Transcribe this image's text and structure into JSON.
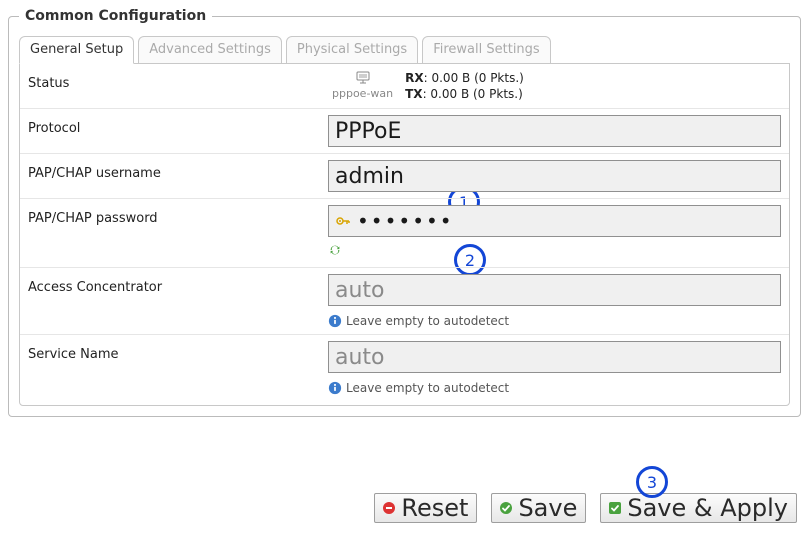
{
  "fieldset_title": "Common Configuration",
  "tabs": {
    "general": "General Setup",
    "advanced": "Advanced Settings",
    "physical": "Physical Settings",
    "firewall": "Firewall Settings"
  },
  "rows": {
    "status_label": "Status",
    "status_iface": "pppoe-wan",
    "status_rx_label": "RX",
    "status_rx_value": "0.00 B (0 Pkts.)",
    "status_tx_label": "TX",
    "status_tx_value": "0.00 B (0 Pkts.)",
    "protocol_label": "Protocol",
    "protocol_value": "PPPoE",
    "username_label": "PAP/CHAP username",
    "username_value": "admin",
    "password_label": "PAP/CHAP password",
    "password_value": "•••••••",
    "ac_label": "Access Concentrator",
    "ac_placeholder": "auto",
    "ac_hint": "Leave empty to autodetect",
    "service_label": "Service Name",
    "service_placeholder": "auto",
    "service_hint": "Leave empty to autodetect"
  },
  "buttons": {
    "reset": "Reset",
    "save": "Save",
    "save_apply": "Save & Apply"
  },
  "annotations": {
    "a1": "1",
    "a2": "2",
    "a3": "3"
  }
}
